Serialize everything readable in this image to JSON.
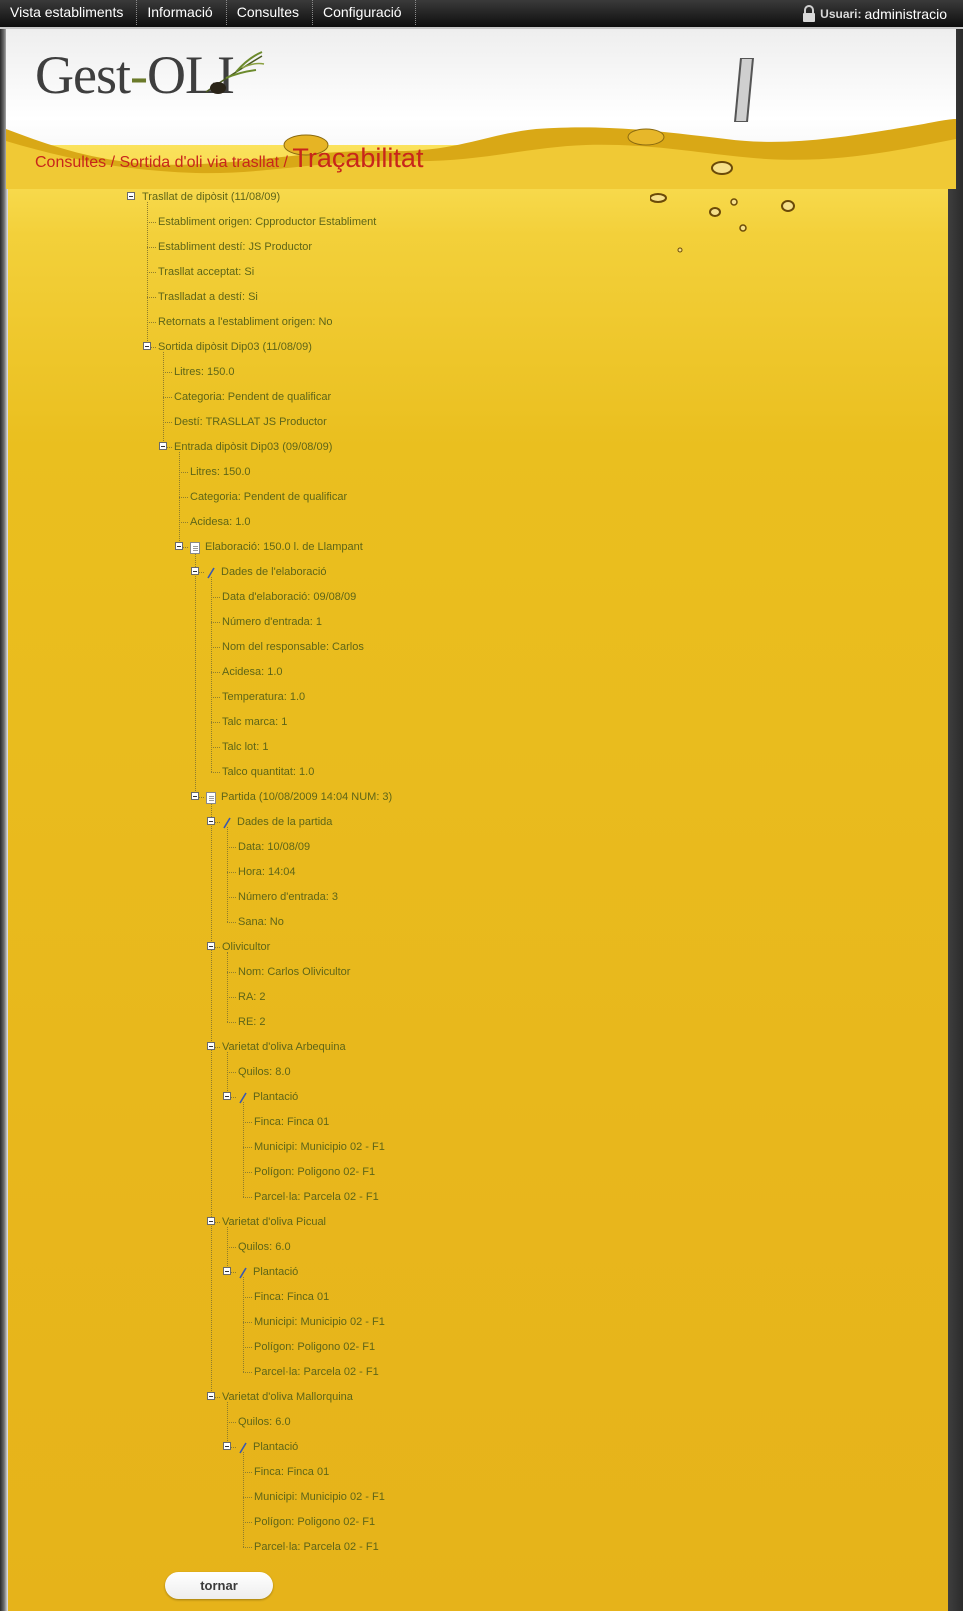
{
  "nav": {
    "items": [
      "Vista establiments",
      "Informació",
      "Consultes",
      "Configuració"
    ],
    "user_label": "Usuari:",
    "user_name": "administracio"
  },
  "logo": {
    "text_a": "Gest",
    "dash": "-",
    "text_b": "OLI"
  },
  "breadcrumb": {
    "path": "Consultes / Sortida d'oli via trasllat /",
    "title": "Traçabilitat"
  },
  "tree": [
    {
      "label": "Trasllat de dipòsit (11/08/09)",
      "depth": 0,
      "expandable": true
    },
    {
      "label": "Establiment origen: Cpproductor Establiment",
      "depth": 1
    },
    {
      "label": "Establiment destí: JS Productor",
      "depth": 1
    },
    {
      "label": "Trasllat acceptat: Si",
      "depth": 1
    },
    {
      "label": "Traslladat a destí: Si",
      "depth": 1
    },
    {
      "label": "Retornats a l'establiment origen: No",
      "depth": 1
    },
    {
      "label": "Sortida dipòsit Dip03 (11/08/09)",
      "depth": 1,
      "expandable": true
    },
    {
      "label": "Litres: 150.0",
      "depth": 2
    },
    {
      "label": "Categoria: Pendent de qualificar",
      "depth": 2
    },
    {
      "label": "Destí: TRASLLAT JS Productor",
      "depth": 2
    },
    {
      "label": "Entrada dipòsit Dip03 (09/08/09)",
      "depth": 2,
      "expandable": true
    },
    {
      "label": "Litres: 150.0",
      "depth": 3
    },
    {
      "label": "Categoria: Pendent de qualificar",
      "depth": 3
    },
    {
      "label": "Acidesa: 1.0",
      "depth": 3
    },
    {
      "label": "Elaboració: 150.0 l. de Llampant",
      "depth": 3,
      "expandable": true,
      "icon": "page"
    },
    {
      "label": "Dades de l'elaboració",
      "depth": 4,
      "expandable": true,
      "icon": "pen"
    },
    {
      "label": "Data d'elaboració: 09/08/09",
      "depth": 5
    },
    {
      "label": "Número d'entrada: 1",
      "depth": 5
    },
    {
      "label": "Nom del responsable: Carlos",
      "depth": 5
    },
    {
      "label": "Acidesa: 1.0",
      "depth": 5
    },
    {
      "label": "Temperatura: 1.0",
      "depth": 5
    },
    {
      "label": "Talc marca: 1",
      "depth": 5
    },
    {
      "label": "Talc lot: 1",
      "depth": 5
    },
    {
      "label": "Talco quantitat: 1.0",
      "depth": 5
    },
    {
      "label": "Partida (10/08/2009 14:04 NUM: 3)",
      "depth": 4,
      "expandable": true,
      "icon": "page"
    },
    {
      "label": "Dades de la partida",
      "depth": 5,
      "expandable": true,
      "icon": "pen"
    },
    {
      "label": "Data: 10/08/09",
      "depth": 6
    },
    {
      "label": "Hora: 14:04",
      "depth": 6
    },
    {
      "label": "Número d'entrada: 3",
      "depth": 6
    },
    {
      "label": "Sana: No",
      "depth": 6
    },
    {
      "label": "Olivicultor",
      "depth": 5,
      "expandable": true
    },
    {
      "label": "Nom: Carlos Olivicultor",
      "depth": 6
    },
    {
      "label": "RA: 2",
      "depth": 6
    },
    {
      "label": "RE: 2",
      "depth": 6
    },
    {
      "label": "Varietat d'oliva Arbequina",
      "depth": 5,
      "expandable": true
    },
    {
      "label": "Quilos: 8.0",
      "depth": 6
    },
    {
      "label": "Plantació",
      "depth": 6,
      "expandable": true,
      "icon": "pen"
    },
    {
      "label": "Finca: Finca 01",
      "depth": 7
    },
    {
      "label": "Municipi: Municipio 02 - F1",
      "depth": 7
    },
    {
      "label": "Polígon: Poligono 02- F1",
      "depth": 7
    },
    {
      "label": "Parcel·la: Parcela 02 - F1",
      "depth": 7
    },
    {
      "label": "Varietat d'oliva Picual",
      "depth": 5,
      "expandable": true
    },
    {
      "label": "Quilos: 6.0",
      "depth": 6
    },
    {
      "label": "Plantació",
      "depth": 6,
      "expandable": true,
      "icon": "pen"
    },
    {
      "label": "Finca: Finca 01",
      "depth": 7
    },
    {
      "label": "Municipi: Municipio 02 - F1",
      "depth": 7
    },
    {
      "label": "Polígon: Poligono 02- F1",
      "depth": 7
    },
    {
      "label": "Parcel·la: Parcela 02 - F1",
      "depth": 7
    },
    {
      "label": "Varietat d'oliva Mallorquina",
      "depth": 5,
      "expandable": true
    },
    {
      "label": "Quilos: 6.0",
      "depth": 6
    },
    {
      "label": "Plantació",
      "depth": 6,
      "expandable": true,
      "icon": "pen"
    },
    {
      "label": "Finca: Finca 01",
      "depth": 7
    },
    {
      "label": "Municipi: Municipio 02 - F1",
      "depth": 7
    },
    {
      "label": "Polígon: Poligono 02- F1",
      "depth": 7
    },
    {
      "label": "Parcel·la: Parcela 02 - F1",
      "depth": 7
    }
  ],
  "buttons": {
    "back": "tornar"
  },
  "colors": {
    "nav_bg": "#1a1a1a",
    "breadcrumb": "#c8261b",
    "tree_text": "#5e6518",
    "oil": "#e8b71c"
  }
}
